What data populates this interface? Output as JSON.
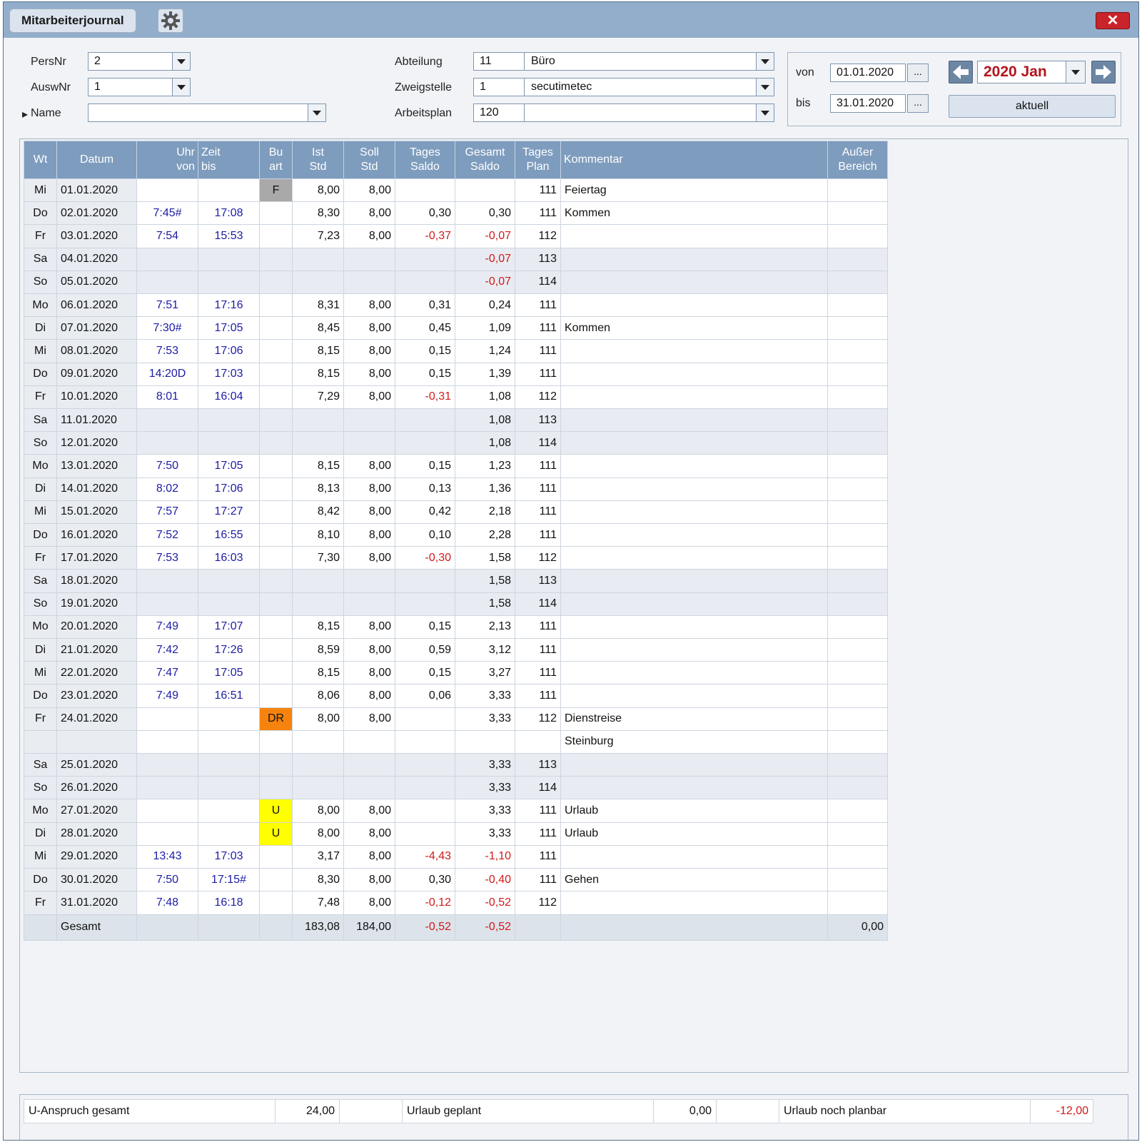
{
  "window": {
    "tab_label": "Mitarbeiterjournal",
    "close_label": "✕"
  },
  "filters": {
    "persnr_label": "PersNr",
    "persnr_value": "2",
    "auswnr_label": "AuswNr",
    "auswnr_value": "1",
    "name_label": "Name",
    "name_value": "",
    "abteilung_label": "Abteilung",
    "abteilung_nr": "11",
    "abteilung_name": "Büro",
    "zweigstelle_label": "Zweigstelle",
    "zweigstelle_nr": "1",
    "zweigstelle_name": "secutimetec",
    "arbeitsplan_label": "Arbeitsplan",
    "arbeitsplan_nr": "120",
    "arbeitsplan_name": ""
  },
  "range": {
    "von_label": "von",
    "von_value": "01.01.2020",
    "bis_label": "bis",
    "bis_value": "31.01.2020",
    "dots": "...",
    "month_value": "2020 Jan",
    "aktuell_label": "aktuell"
  },
  "table": {
    "headers": [
      {
        "lines": [
          "Wt"
        ]
      },
      {
        "lines": [
          "Datum"
        ]
      },
      {
        "lines": [
          "Uhr",
          "von"
        ]
      },
      {
        "lines": [
          "Zeit",
          "bis"
        ]
      },
      {
        "lines": [
          "Bu",
          "art"
        ]
      },
      {
        "lines": [
          "Ist",
          "Std"
        ]
      },
      {
        "lines": [
          "Soll",
          "Std"
        ]
      },
      {
        "lines": [
          "Tages",
          "Saldo"
        ]
      },
      {
        "lines": [
          "Gesamt",
          "Saldo"
        ]
      },
      {
        "lines": [
          "Tages",
          "Plan"
        ]
      },
      {
        "lines": [
          "Kommentar"
        ]
      },
      {
        "lines": [
          "Außer",
          "Bereich"
        ]
      }
    ],
    "rows": [
      {
        "wt": "Mi",
        "datum": "01.01.2020",
        "von": "",
        "bis": "",
        "buart": "F",
        "ist": "8,00",
        "soll": "8,00",
        "tsaldo": "",
        "gsaldo": "",
        "plan": "111",
        "kommentar": "Feiertag",
        "ausser": ""
      },
      {
        "wt": "Do",
        "datum": "02.01.2020",
        "von": "7:45#",
        "bis": "17:08",
        "buart": "",
        "ist": "8,30",
        "soll": "8,00",
        "tsaldo": "0,30",
        "gsaldo": "0,30",
        "plan": "111",
        "kommentar": "Kommen",
        "ausser": ""
      },
      {
        "wt": "Fr",
        "datum": "03.01.2020",
        "von": "7:54",
        "bis": "15:53",
        "buart": "",
        "ist": "7,23",
        "soll": "8,00",
        "tsaldo": "-0,37",
        "gsaldo": "-0,07",
        "plan": "112",
        "kommentar": "",
        "ausser": ""
      },
      {
        "wt": "Sa",
        "datum": "04.01.2020",
        "von": "",
        "bis": "",
        "buart": "",
        "ist": "",
        "soll": "",
        "tsaldo": "",
        "gsaldo": "-0,07",
        "plan": "113",
        "kommentar": "",
        "ausser": ""
      },
      {
        "wt": "So",
        "datum": "05.01.2020",
        "von": "",
        "bis": "",
        "buart": "",
        "ist": "",
        "soll": "",
        "tsaldo": "",
        "gsaldo": "-0,07",
        "plan": "114",
        "kommentar": "",
        "ausser": ""
      },
      {
        "wt": "Mo",
        "datum": "06.01.2020",
        "von": "7:51",
        "bis": "17:16",
        "buart": "",
        "ist": "8,31",
        "soll": "8,00",
        "tsaldo": "0,31",
        "gsaldo": "0,24",
        "plan": "111",
        "kommentar": "",
        "ausser": ""
      },
      {
        "wt": "Di",
        "datum": "07.01.2020",
        "von": "7:30#",
        "bis": "17:05",
        "buart": "",
        "ist": "8,45",
        "soll": "8,00",
        "tsaldo": "0,45",
        "gsaldo": "1,09",
        "plan": "111",
        "kommentar": "Kommen",
        "ausser": ""
      },
      {
        "wt": "Mi",
        "datum": "08.01.2020",
        "von": "7:53",
        "bis": "17:06",
        "buart": "",
        "ist": "8,15",
        "soll": "8,00",
        "tsaldo": "0,15",
        "gsaldo": "1,24",
        "plan": "111",
        "kommentar": "",
        "ausser": ""
      },
      {
        "wt": "Do",
        "datum": "09.01.2020",
        "von": "14:20D",
        "bis": "17:03",
        "buart": "",
        "ist": "8,15",
        "soll": "8,00",
        "tsaldo": "0,15",
        "gsaldo": "1,39",
        "plan": "111",
        "kommentar": "",
        "ausser": ""
      },
      {
        "wt": "Fr",
        "datum": "10.01.2020",
        "von": "8:01",
        "bis": "16:04",
        "buart": "",
        "ist": "7,29",
        "soll": "8,00",
        "tsaldo": "-0,31",
        "gsaldo": "1,08",
        "plan": "112",
        "kommentar": "",
        "ausser": ""
      },
      {
        "wt": "Sa",
        "datum": "11.01.2020",
        "von": "",
        "bis": "",
        "buart": "",
        "ist": "",
        "soll": "",
        "tsaldo": "",
        "gsaldo": "1,08",
        "plan": "113",
        "kommentar": "",
        "ausser": ""
      },
      {
        "wt": "So",
        "datum": "12.01.2020",
        "von": "",
        "bis": "",
        "buart": "",
        "ist": "",
        "soll": "",
        "tsaldo": "",
        "gsaldo": "1,08",
        "plan": "114",
        "kommentar": "",
        "ausser": ""
      },
      {
        "wt": "Mo",
        "datum": "13.01.2020",
        "von": "7:50",
        "bis": "17:05",
        "buart": "",
        "ist": "8,15",
        "soll": "8,00",
        "tsaldo": "0,15",
        "gsaldo": "1,23",
        "plan": "111",
        "kommentar": "",
        "ausser": ""
      },
      {
        "wt": "Di",
        "datum": "14.01.2020",
        "von": "8:02",
        "bis": "17:06",
        "buart": "",
        "ist": "8,13",
        "soll": "8,00",
        "tsaldo": "0,13",
        "gsaldo": "1,36",
        "plan": "111",
        "kommentar": "",
        "ausser": ""
      },
      {
        "wt": "Mi",
        "datum": "15.01.2020",
        "von": "7:57",
        "bis": "17:27",
        "buart": "",
        "ist": "8,42",
        "soll": "8,00",
        "tsaldo": "0,42",
        "gsaldo": "2,18",
        "plan": "111",
        "kommentar": "",
        "ausser": ""
      },
      {
        "wt": "Do",
        "datum": "16.01.2020",
        "von": "7:52",
        "bis": "16:55",
        "buart": "",
        "ist": "8,10",
        "soll": "8,00",
        "tsaldo": "0,10",
        "gsaldo": "2,28",
        "plan": "111",
        "kommentar": "",
        "ausser": ""
      },
      {
        "wt": "Fr",
        "datum": "17.01.2020",
        "von": "7:53",
        "bis": "16:03",
        "buart": "",
        "ist": "7,30",
        "soll": "8,00",
        "tsaldo": "-0,30",
        "gsaldo": "1,58",
        "plan": "112",
        "kommentar": "",
        "ausser": ""
      },
      {
        "wt": "Sa",
        "datum": "18.01.2020",
        "von": "",
        "bis": "",
        "buart": "",
        "ist": "",
        "soll": "",
        "tsaldo": "",
        "gsaldo": "1,58",
        "plan": "113",
        "kommentar": "",
        "ausser": ""
      },
      {
        "wt": "So",
        "datum": "19.01.2020",
        "von": "",
        "bis": "",
        "buart": "",
        "ist": "",
        "soll": "",
        "tsaldo": "",
        "gsaldo": "1,58",
        "plan": "114",
        "kommentar": "",
        "ausser": ""
      },
      {
        "wt": "Mo",
        "datum": "20.01.2020",
        "von": "7:49",
        "bis": "17:07",
        "buart": "",
        "ist": "8,15",
        "soll": "8,00",
        "tsaldo": "0,15",
        "gsaldo": "2,13",
        "plan": "111",
        "kommentar": "",
        "ausser": ""
      },
      {
        "wt": "Di",
        "datum": "21.01.2020",
        "von": "7:42",
        "bis": "17:26",
        "buart": "",
        "ist": "8,59",
        "soll": "8,00",
        "tsaldo": "0,59",
        "gsaldo": "3,12",
        "plan": "111",
        "kommentar": "",
        "ausser": ""
      },
      {
        "wt": "Mi",
        "datum": "22.01.2020",
        "von": "7:47",
        "bis": "17:05",
        "buart": "",
        "ist": "8,15",
        "soll": "8,00",
        "tsaldo": "0,15",
        "gsaldo": "3,27",
        "plan": "111",
        "kommentar": "",
        "ausser": ""
      },
      {
        "wt": "Do",
        "datum": "23.01.2020",
        "von": "7:49",
        "bis": "16:51",
        "buart": "",
        "ist": "8,06",
        "soll": "8,00",
        "tsaldo": "0,06",
        "gsaldo": "3,33",
        "plan": "111",
        "kommentar": "",
        "ausser": ""
      },
      {
        "wt": "Fr",
        "datum": "24.01.2020",
        "von": "",
        "bis": "",
        "buart": "DR",
        "ist": "8,00",
        "soll": "8,00",
        "tsaldo": "",
        "gsaldo": "3,33",
        "plan": "112",
        "kommentar": "Dienstreise",
        "ausser": ""
      },
      {
        "wt": "",
        "datum": "",
        "von": "",
        "bis": "",
        "buart": "",
        "ist": "",
        "soll": "",
        "tsaldo": "",
        "gsaldo": "",
        "plan": "",
        "kommentar": "Steinburg",
        "ausser": ""
      },
      {
        "wt": "Sa",
        "datum": "25.01.2020",
        "von": "",
        "bis": "",
        "buart": "",
        "ist": "",
        "soll": "",
        "tsaldo": "",
        "gsaldo": "3,33",
        "plan": "113",
        "kommentar": "",
        "ausser": ""
      },
      {
        "wt": "So",
        "datum": "26.01.2020",
        "von": "",
        "bis": "",
        "buart": "",
        "ist": "",
        "soll": "",
        "tsaldo": "",
        "gsaldo": "3,33",
        "plan": "114",
        "kommentar": "",
        "ausser": ""
      },
      {
        "wt": "Mo",
        "datum": "27.01.2020",
        "von": "",
        "bis": "",
        "buart": "U",
        "ist": "8,00",
        "soll": "8,00",
        "tsaldo": "",
        "gsaldo": "3,33",
        "plan": "111",
        "kommentar": "Urlaub",
        "ausser": ""
      },
      {
        "wt": "Di",
        "datum": "28.01.2020",
        "von": "",
        "bis": "",
        "buart": "U",
        "ist": "8,00",
        "soll": "8,00",
        "tsaldo": "",
        "gsaldo": "3,33",
        "plan": "111",
        "kommentar": "Urlaub",
        "ausser": ""
      },
      {
        "wt": "Mi",
        "datum": "29.01.2020",
        "von": "13:43",
        "bis": "17:03",
        "buart": "",
        "ist": "3,17",
        "soll": "8,00",
        "tsaldo": "-4,43",
        "gsaldo": "-1,10",
        "plan": "111",
        "kommentar": "",
        "ausser": ""
      },
      {
        "wt": "Do",
        "datum": "30.01.2020",
        "von": "7:50",
        "bis": "17:15#",
        "buart": "",
        "ist": "8,30",
        "soll": "8,00",
        "tsaldo": "0,30",
        "gsaldo": "-0,40",
        "plan": "111",
        "kommentar": "Gehen",
        "ausser": ""
      },
      {
        "wt": "Fr",
        "datum": "31.01.2020",
        "von": "7:48",
        "bis": "16:18",
        "buart": "",
        "ist": "7,48",
        "soll": "8,00",
        "tsaldo": "-0,12",
        "gsaldo": "-0,52",
        "plan": "112",
        "kommentar": "",
        "ausser": ""
      }
    ],
    "total": {
      "label": "Gesamt",
      "ist": "183,08",
      "soll": "184,00",
      "tsaldo": "-0,52",
      "gsaldo": "-0,52",
      "ausser": "0,00"
    }
  },
  "buchungsart_colors": {
    "F": "#a9a9a9",
    "DR": "#f7830f",
    "U": "#ffff00"
  },
  "summary": {
    "u_anspruch_label": "U-Anspruch gesamt",
    "u_anspruch_value": "24,00",
    "urlaub_geplant_label": "Urlaub geplant",
    "urlaub_geplant_value": "0,00",
    "urlaub_planbar_label": "Urlaub noch planbar",
    "urlaub_planbar_value": "-12,00"
  }
}
